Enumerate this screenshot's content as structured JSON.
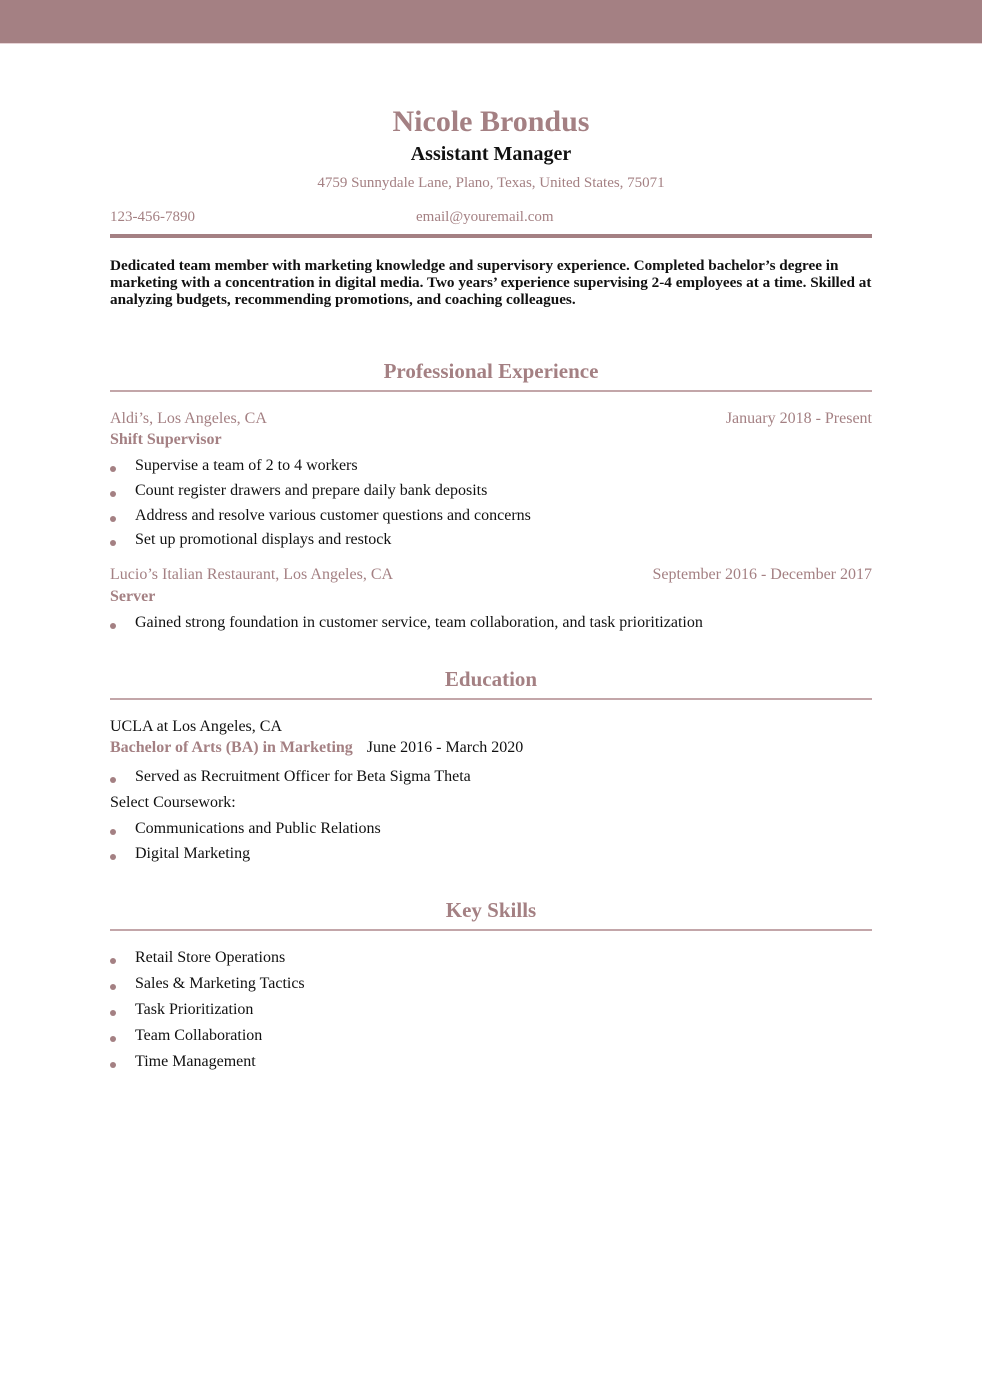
{
  "header": {
    "name": "Nicole Brondus",
    "title": "Assistant Manager",
    "address": "4759 Sunnydale Lane, Plano, Texas, United States, 75071",
    "phone": "123-456-7890",
    "email": "email@youremail.com"
  },
  "summary": "Dedicated team member with marketing knowledge and supervisory experience. Completed bachelor’s degree in marketing with a concentration in digital media. Two years’ experience supervising 2-4 employees at a time. Skilled at analyzing budgets, recommending promotions, and coaching colleagues.",
  "experience": {
    "heading": "Professional Experience",
    "jobs": [
      {
        "employer": "Aldi’s, Los Angeles, CA",
        "dates": "January 2018 - Present",
        "position": "Shift Supervisor",
        "bullets": [
          "Supervise a team of 2 to 4 workers",
          "Count register drawers and prepare daily bank deposits",
          "Address and resolve various customer questions and concerns",
          "Set up promotional displays and restock"
        ]
      },
      {
        "employer": "Lucio’s Italian Restaurant, Los Angeles, CA",
        "dates": "September 2016 - December 2017",
        "position": "Server",
        "bullets": [
          "Gained strong foundation in customer service, team collaboration, and task prioritization"
        ]
      }
    ]
  },
  "education": {
    "heading": "Education",
    "school": "UCLA at Los Angeles, CA",
    "degree": "Bachelor of Arts (BA) in Marketing",
    "dates": "June 2016 - March 2020",
    "bullets": [
      "Served as Recruitment Officer for Beta Sigma Theta"
    ],
    "coursework_label": "Select Coursework:",
    "coursework": [
      "Communications and Public Relations",
      "Digital Marketing"
    ]
  },
  "skills": {
    "heading": "Key Skills",
    "items": [
      "Retail Store Operations",
      "Sales & Marketing Tactics",
      "Task Prioritization",
      "Team Collaboration",
      "Time Management"
    ]
  },
  "colors": {
    "accent": "#a48083",
    "text": "#111111",
    "rule_light": "#c3a6a9"
  }
}
